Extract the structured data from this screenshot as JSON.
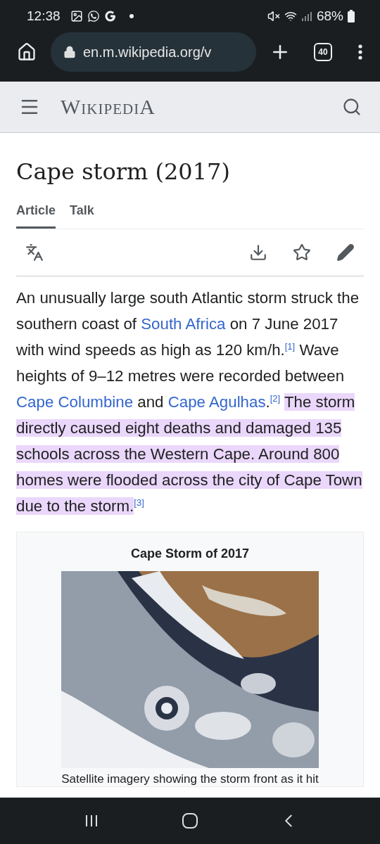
{
  "status_bar": {
    "time": "12:38",
    "battery": "68%"
  },
  "browser": {
    "url": "en.m.wikipedia.org/v",
    "tab_count": "40"
  },
  "header": {
    "logo": "WikipediA"
  },
  "article": {
    "title": "Cape storm (2017)",
    "tabs": [
      {
        "label": "Article",
        "selected": true
      },
      {
        "label": "Talk",
        "selected": false
      }
    ],
    "paragraph": [
      {
        "kind": "text",
        "text": "An unusually large south Atlantic storm struck the southern coast of "
      },
      {
        "kind": "link",
        "text": "South Africa"
      },
      {
        "kind": "text",
        "text": " on 7 June 2017 with wind speeds as high as 120 km/h."
      },
      {
        "kind": "ref",
        "text": "[1]"
      },
      {
        "kind": "text",
        "text": " Wave heights of 9–12 metres were recorded between "
      },
      {
        "kind": "link",
        "text": "Cape Columbine"
      },
      {
        "kind": "text",
        "text": " and "
      },
      {
        "kind": "link",
        "text": "Cape Agulhas"
      },
      {
        "kind": "text",
        "text": "."
      },
      {
        "kind": "ref",
        "text": "[2]"
      },
      {
        "kind": "highlight",
        "text": "The storm directly caused eight deaths and damaged 135 schools across the Western Cape. Around 800 homes were flooded across the city of Cape Town due to the storm."
      },
      {
        "kind": "ref",
        "text": "[3]"
      }
    ]
  },
  "infobox": {
    "title": "Cape Storm of 2017",
    "caption": "Satellite imagery showing the storm front as it hit"
  }
}
